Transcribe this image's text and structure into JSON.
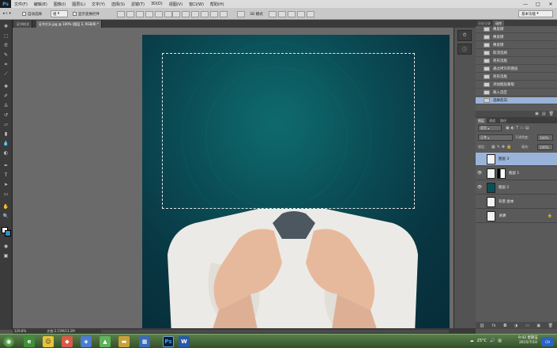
{
  "app": {
    "logo": "Ps"
  },
  "menu": [
    "文件(F)",
    "编辑(E)",
    "图像(I)",
    "图层(L)",
    "文字(Y)",
    "选择(S)",
    "滤镜(T)",
    "3D(D)",
    "视图(V)",
    "窗口(W)",
    "帮助(H)"
  ],
  "window_controls": [
    "—",
    "□",
    "✕"
  ],
  "options": {
    "auto_select": "自动选择",
    "layer_dropdown": "组",
    "show_transform": "显示变换控件",
    "mode_3d": "3D 模式",
    "workspace": "基本功能"
  },
  "document": {
    "tab_title": "证书样式",
    "tab_active": "证书大头.jpg @ 100% (图层 3, RGB/8) *"
  },
  "status": {
    "zoom": "129.8%",
    "doc_size": "文档:2.15M/13.2M"
  },
  "history": {
    "tabs": [
      "历史记录",
      "动作"
    ],
    "items": [
      "橡皮擦",
      "橡皮擦",
      "橡皮擦",
      "取消选择",
      "矩形选框",
      "通过拷贝的图层",
      "矩形选框",
      "添加图层蒙版",
      "载入选区",
      "选择反向"
    ],
    "selected_index": 9
  },
  "layers": {
    "tabs": [
      "图层",
      "通道",
      "路径"
    ],
    "kind_label": "类型",
    "blend_mode": "正常",
    "opacity_label": "不透明度:",
    "opacity_value": "100%",
    "lock_label": "锁定:",
    "fill_label": "填充:",
    "fill_value": "100%",
    "items": [
      {
        "name": "图层 3",
        "selected": true,
        "visible": false,
        "has_mask": false
      },
      {
        "name": "图层 1",
        "selected": false,
        "visible": true,
        "has_mask": true
      },
      {
        "name": "图层 2",
        "selected": false,
        "visible": true,
        "has_mask": false
      },
      {
        "name": "背景 副本",
        "selected": false,
        "visible": false,
        "has_mask": false
      },
      {
        "name": "背景",
        "selected": false,
        "visible": false,
        "has_mask": false
      }
    ]
  },
  "taskbar": {
    "apps": [
      "Ps",
      "W"
    ],
    "time": "9:42 星期五",
    "date": "2015/7/10",
    "temp": "25°C",
    "input_method": "CH"
  },
  "colors": {
    "canvas_dark": "#062d39",
    "canvas_light": "#0f6a6d",
    "selection_highlight": "#9ab3d8",
    "ps_blue": "#31a8ff"
  }
}
